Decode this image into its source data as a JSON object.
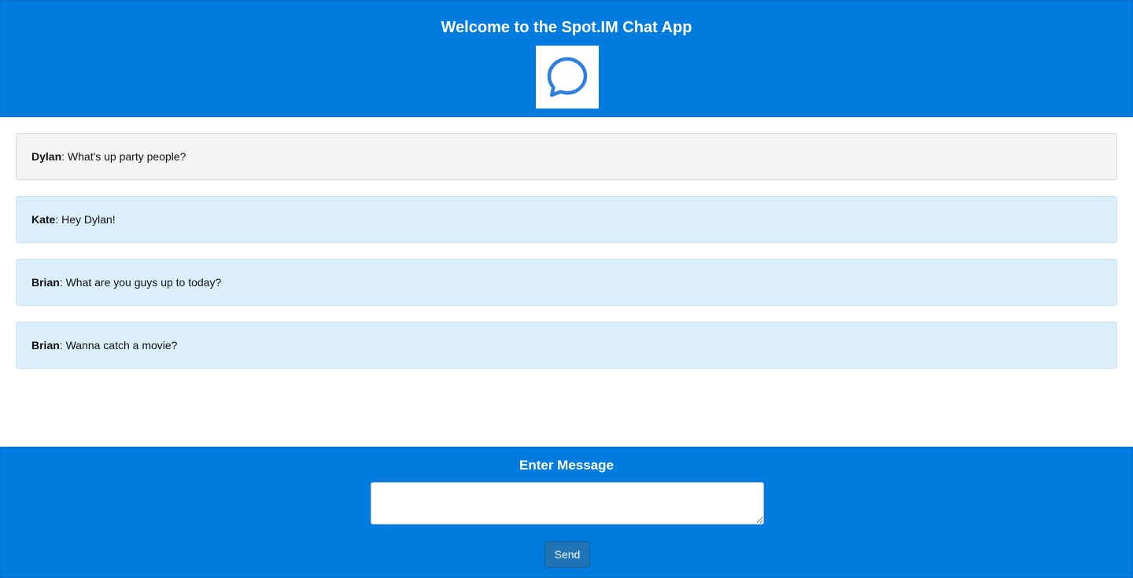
{
  "header": {
    "title": "Welcome to the Spot.IM Chat App",
    "logo_icon": "chat-bubble-icon",
    "logo_color": "#2f7fe0"
  },
  "messages": [
    {
      "author": "Dylan",
      "text": "What's up party people?",
      "style": "self"
    },
    {
      "author": "Kate",
      "text": "Hey Dylan!",
      "style": "other"
    },
    {
      "author": "Brian",
      "text": "What are you guys up to today?",
      "style": "other"
    },
    {
      "author": "Brian",
      "text": "Wanna catch a movie?",
      "style": "other"
    }
  ],
  "composer": {
    "title": "Enter Message",
    "value": "",
    "send_label": "Send"
  },
  "colors": {
    "brand_blue": "#007ce0",
    "self_message_bg": "#f4f4f4",
    "other_message_bg": "#dbeffd",
    "send_button": "#1f73b7"
  }
}
